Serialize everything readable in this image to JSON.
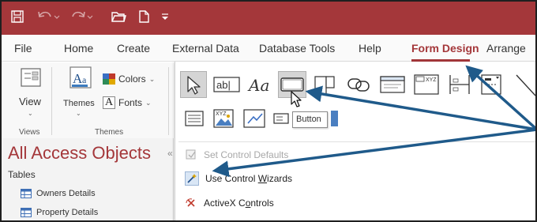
{
  "menu": {
    "tabs": [
      {
        "label": "File"
      },
      {
        "label": "Home"
      },
      {
        "label": "Create"
      },
      {
        "label": "External Data"
      },
      {
        "label": "Database Tools"
      },
      {
        "label": "Help"
      },
      {
        "label": "Form Design",
        "active": true
      },
      {
        "label": "Arrange"
      }
    ]
  },
  "ribbon": {
    "views_group": {
      "view_label": "View",
      "group_label": "Views"
    },
    "themes_group": {
      "themes_label": "Themes",
      "colors_label": "Colors",
      "fonts_label": "Fonts",
      "group_label": "Themes"
    },
    "controls": {
      "textbox_label": "ab|",
      "label_label": "Aa",
      "button_tooltip": "Button"
    }
  },
  "dropdown": {
    "set_defaults": "Set Control Defaults",
    "wizards_prefix": "Use Control ",
    "wizards_underlined": "W",
    "wizards_suffix": "izards",
    "activex_prefix": "ActiveX C",
    "activex_underlined": "o",
    "activex_suffix": "ntrols"
  },
  "nav": {
    "title": "All Access Objects",
    "section": "Tables",
    "items": [
      {
        "label": "Owners Details"
      },
      {
        "label": "Property Details"
      }
    ]
  },
  "colors": {
    "accent": "#a4373a",
    "arrow": "#1f5a8a"
  }
}
